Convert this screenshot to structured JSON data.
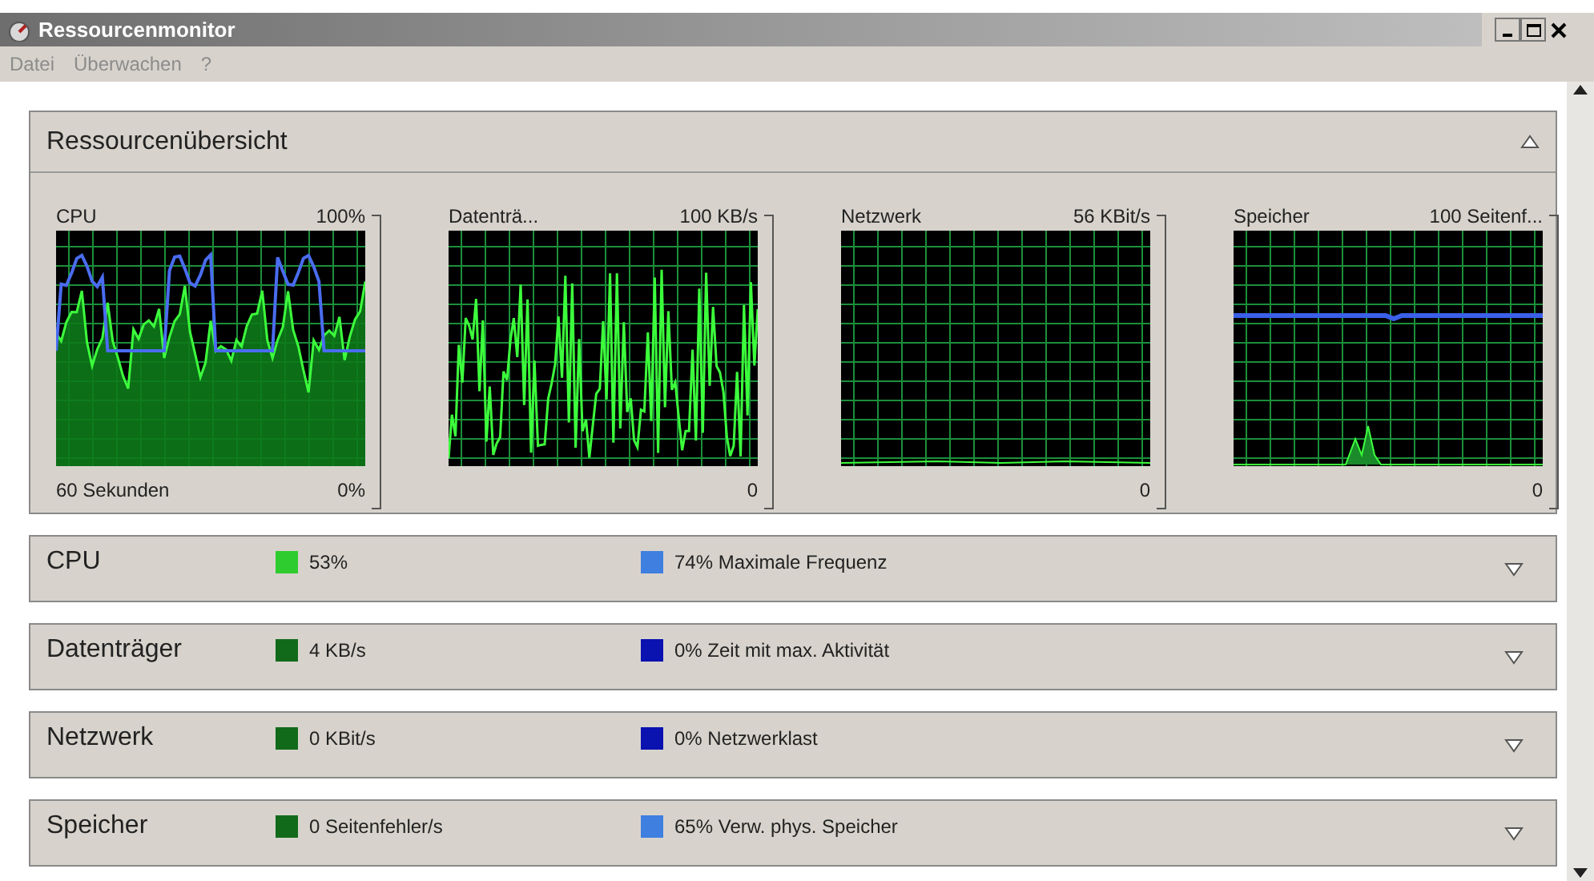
{
  "window": {
    "title": "Ressourcenmonitor"
  },
  "menu": [
    "Datei",
    "Überwachen",
    "?"
  ],
  "overview": {
    "title": "Ressourcenübersicht",
    "expanded": true,
    "graphs": [
      {
        "label": "CPU",
        "max": "100%",
        "time": "60 Sekunden",
        "min": "0%"
      },
      {
        "label": "Datenträ...",
        "max": "100 KB/s",
        "min": "0"
      },
      {
        "label": "Netzwerk",
        "max": "56 KBit/s",
        "min": "0"
      },
      {
        "label": "Speicher",
        "max": "100 Seitenf...",
        "min": "0"
      }
    ]
  },
  "sections": [
    {
      "title": "CPU",
      "expanded": false,
      "primary": {
        "text": "53%",
        "color": "#2ecc2e"
      },
      "secondary": {
        "text": "74% Maximale Frequenz",
        "color": "#3f7fe0"
      }
    },
    {
      "title": "Datenträger",
      "expanded": false,
      "primary": {
        "text": "4 KB/s",
        "color": "#116a1a"
      },
      "secondary": {
        "text": "0% Zeit mit max. Aktivität",
        "color": "#0a12b0"
      }
    },
    {
      "title": "Netzwerk",
      "expanded": false,
      "primary": {
        "text": "0 KBit/s",
        "color": "#116a1a"
      },
      "secondary": {
        "text": "0% Netzwerklast",
        "color": "#0a12b0"
      }
    },
    {
      "title": "Speicher",
      "expanded": false,
      "primary": {
        "text": "0 Seitenfehler/s",
        "color": "#116a1a"
      },
      "secondary": {
        "text": "65% Verw. phys. Speicher",
        "color": "#3f7fe0"
      }
    }
  ]
}
